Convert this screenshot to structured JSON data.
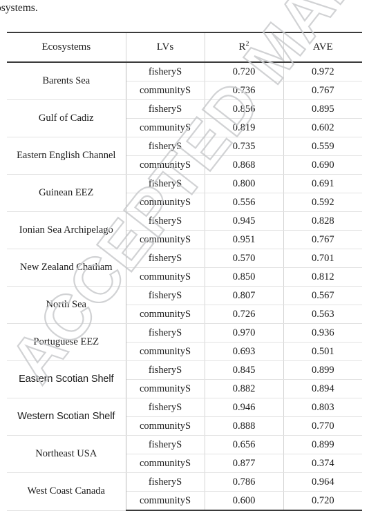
{
  "caption_fragment": "osystems.",
  "watermark": {
    "text": "ACCEPTED MANUSCRIPT",
    "color": "#c9cbcd"
  },
  "table": {
    "columns": [
      {
        "key": "ecosystems",
        "label": "Ecosystems"
      },
      {
        "key": "lvs",
        "label": "LVs"
      },
      {
        "key": "r2",
        "label": "R",
        "superscript": "2"
      },
      {
        "key": "ave",
        "label": "AVE"
      }
    ],
    "lv_labels": {
      "fishery": "fisheryS",
      "community": "communityS"
    },
    "rows": [
      {
        "ecosystem": "Barents Sea",
        "font": "serif",
        "measures": [
          {
            "lv": "fisheryS",
            "r2": "0.720",
            "ave": "0.972"
          },
          {
            "lv": "communityS",
            "r2": "0.736",
            "ave": "0.767"
          }
        ]
      },
      {
        "ecosystem": "Gulf of Cadiz",
        "font": "serif",
        "measures": [
          {
            "lv": "fisheryS",
            "r2": "0.856",
            "ave": "0.895"
          },
          {
            "lv": "communityS",
            "r2": "0.819",
            "ave": "0.602"
          }
        ]
      },
      {
        "ecosystem": "Eastern English Channel",
        "font": "serif",
        "measures": [
          {
            "lv": "fisheryS",
            "r2": "0.735",
            "ave": "0.559"
          },
          {
            "lv": "communityS",
            "r2": "0.868",
            "ave": "0.690"
          }
        ]
      },
      {
        "ecosystem": "Guinean EEZ",
        "font": "serif",
        "measures": [
          {
            "lv": "fisheryS",
            "r2": "0.800",
            "ave": "0.691"
          },
          {
            "lv": "communityS",
            "r2": "0.556",
            "ave": "0.592"
          }
        ]
      },
      {
        "ecosystem": "Ionian Sea Archipelago",
        "font": "serif",
        "measures": [
          {
            "lv": "fisheryS",
            "r2": "0.945",
            "ave": "0.828"
          },
          {
            "lv": "communityS",
            "r2": "0.951",
            "ave": "0.767"
          }
        ]
      },
      {
        "ecosystem": "New Zealand Chatham",
        "font": "serif",
        "measures": [
          {
            "lv": "fisheryS",
            "r2": "0.570",
            "ave": "0.701"
          },
          {
            "lv": "communityS",
            "r2": "0.850",
            "ave": "0.812"
          }
        ]
      },
      {
        "ecosystem": "North Sea",
        "font": "serif",
        "measures": [
          {
            "lv": "fisheryS",
            "r2": "0.807",
            "ave": "0.567"
          },
          {
            "lv": "communityS",
            "r2": "0.726",
            "ave": "0.563"
          }
        ]
      },
      {
        "ecosystem": "Portuguese EEZ",
        "font": "serif",
        "measures": [
          {
            "lv": "fisheryS",
            "r2": "0.970",
            "ave": "0.936"
          },
          {
            "lv": "communityS",
            "r2": "0.693",
            "ave": "0.501"
          }
        ]
      },
      {
        "ecosystem": "Eastern Scotian Shelf",
        "font": "sans",
        "measures": [
          {
            "lv": "fisheryS",
            "r2": "0.845",
            "ave": "0.899"
          },
          {
            "lv": "communityS",
            "r2": "0.882",
            "ave": "0.894"
          }
        ]
      },
      {
        "ecosystem": "Western Scotian Shelf",
        "font": "sans",
        "measures": [
          {
            "lv": "fisheryS",
            "r2": "0.946",
            "ave": "0.803"
          },
          {
            "lv": "communityS",
            "r2": "0.888",
            "ave": "0.770"
          }
        ]
      },
      {
        "ecosystem": "Northeast USA",
        "font": "serif",
        "measures": [
          {
            "lv": "fisheryS",
            "r2": "0.656",
            "ave": "0.899"
          },
          {
            "lv": "communityS",
            "r2": "0.877",
            "ave": "0.374"
          }
        ]
      },
      {
        "ecosystem": "West Coast Canada",
        "font": "serif",
        "measures": [
          {
            "lv": "fisheryS",
            "r2": "0.786",
            "ave": "0.964"
          },
          {
            "lv": "communityS",
            "r2": "0.600",
            "ave": "0.720"
          }
        ]
      }
    ]
  }
}
